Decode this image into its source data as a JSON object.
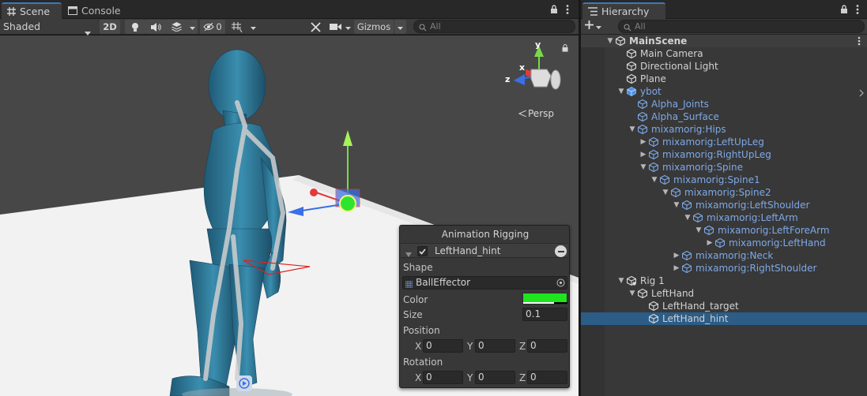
{
  "scene_tabs": [
    {
      "label": "Scene",
      "icon": "grid-icon"
    },
    {
      "label": "Console",
      "icon": "console-icon"
    }
  ],
  "scene_toolbar": {
    "shading_mode": "Shaded",
    "mode_2d": "2D",
    "hidden_count": "0",
    "gizmos_label": "Gizmos",
    "search_placeholder": "All"
  },
  "viewport": {
    "projection_label": "Persp",
    "gizmo_axes": {
      "y": "y",
      "x": "x",
      "z": "z"
    }
  },
  "overlay": {
    "title": "Animation Rigging",
    "component_name": "LeftHand_hint",
    "enabled": true,
    "shape_label": "Shape",
    "shape_value": "BallEffector",
    "color_label": "Color",
    "color_value": "#1ee51e",
    "size_label": "Size",
    "size_value": "0.1",
    "position_label": "Position",
    "rotation_label": "Rotation",
    "position": {
      "x_label": "X",
      "x": "0",
      "y_label": "Y",
      "y": "0",
      "z_label": "Z",
      "z": "0"
    },
    "rotation": {
      "x_label": "X",
      "x": "0",
      "y_label": "Y",
      "y": "0",
      "z_label": "Z",
      "z": "0"
    }
  },
  "hierarchy": {
    "tab_label": "Hierarchy",
    "search_placeholder": "All",
    "rows": [
      {
        "label": "MainScene",
        "depth": 0,
        "arrow": "down",
        "type": "scene"
      },
      {
        "label": "Main Camera",
        "depth": 1,
        "arrow": "none",
        "type": "object"
      },
      {
        "label": "Directional Light",
        "depth": 1,
        "arrow": "none",
        "type": "object"
      },
      {
        "label": "Plane",
        "depth": 1,
        "arrow": "none",
        "type": "object"
      },
      {
        "label": "ybot",
        "depth": 1,
        "arrow": "down",
        "type": "prefab-root"
      },
      {
        "label": "Alpha_Joints",
        "depth": 2,
        "arrow": "none",
        "type": "prefab"
      },
      {
        "label": "Alpha_Surface",
        "depth": 2,
        "arrow": "none",
        "type": "prefab"
      },
      {
        "label": "mixamorig:Hips",
        "depth": 2,
        "arrow": "down",
        "type": "prefab"
      },
      {
        "label": "mixamorig:LeftUpLeg",
        "depth": 3,
        "arrow": "right",
        "type": "prefab"
      },
      {
        "label": "mixamorig:RightUpLeg",
        "depth": 3,
        "arrow": "right",
        "type": "prefab"
      },
      {
        "label": "mixamorig:Spine",
        "depth": 3,
        "arrow": "down",
        "type": "prefab"
      },
      {
        "label": "mixamorig:Spine1",
        "depth": 4,
        "arrow": "down",
        "type": "prefab"
      },
      {
        "label": "mixamorig:Spine2",
        "depth": 5,
        "arrow": "down",
        "type": "prefab"
      },
      {
        "label": "mixamorig:LeftShoulder",
        "depth": 6,
        "arrow": "down",
        "type": "prefab"
      },
      {
        "label": "mixamorig:LeftArm",
        "depth": 7,
        "arrow": "down",
        "type": "prefab"
      },
      {
        "label": "mixamorig:LeftForeArm",
        "depth": 8,
        "arrow": "down",
        "type": "prefab"
      },
      {
        "label": "mixamorig:LeftHand",
        "depth": 9,
        "arrow": "right",
        "type": "prefab"
      },
      {
        "label": "mixamorig:Neck",
        "depth": 6,
        "arrow": "right",
        "type": "prefab"
      },
      {
        "label": "mixamorig:RightShoulder",
        "depth": 6,
        "arrow": "right",
        "type": "prefab"
      },
      {
        "label": "Rig 1",
        "depth": 1,
        "arrow": "down",
        "type": "rig"
      },
      {
        "label": "LeftHand",
        "depth": 2,
        "arrow": "down",
        "type": "object"
      },
      {
        "label": "LeftHand_target",
        "depth": 3,
        "arrow": "none",
        "type": "object"
      },
      {
        "label": "LeftHand_hint",
        "depth": 3,
        "arrow": "none",
        "type": "object",
        "selected": true
      }
    ]
  }
}
